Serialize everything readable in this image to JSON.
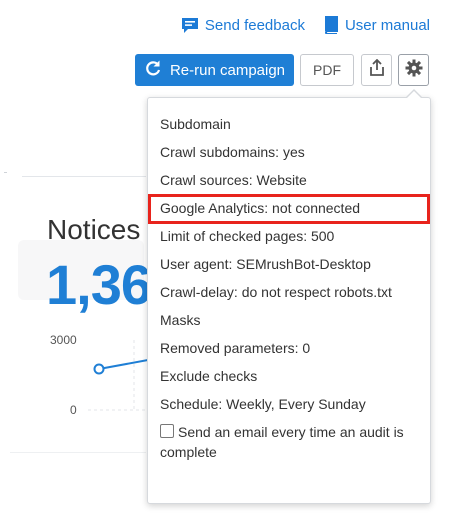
{
  "header": {
    "feedback_label": "Send feedback",
    "manual_label": "User manual"
  },
  "toolbar": {
    "rerun_label": "Re-run campaign",
    "pdf_label": "PDF"
  },
  "widget": {
    "title": "Notices",
    "value": "1,36",
    "y_axis": [
      "3000",
      "0"
    ]
  },
  "settings_menu": {
    "items": [
      "Subdomain",
      "Crawl subdomains: yes",
      "Crawl sources: Website",
      "Google Analytics: not connected",
      "Limit of checked pages: 500",
      "User agent: SEMrushBot-Desktop",
      "Crawl-delay: do not respect robots.txt",
      "Masks",
      "Removed parameters: 0",
      "Exclude checks",
      "Schedule: Weekly, Every Sunday"
    ],
    "email_option": "Send an email every time an audit is complete",
    "email_checked": false,
    "highlighted_index": 3
  },
  "colors": {
    "accent": "#1f7fd5",
    "highlight": "#e8231c"
  },
  "icons": [
    "feedback-icon",
    "book-icon",
    "refresh-icon",
    "share-icon",
    "gear-icon"
  ]
}
